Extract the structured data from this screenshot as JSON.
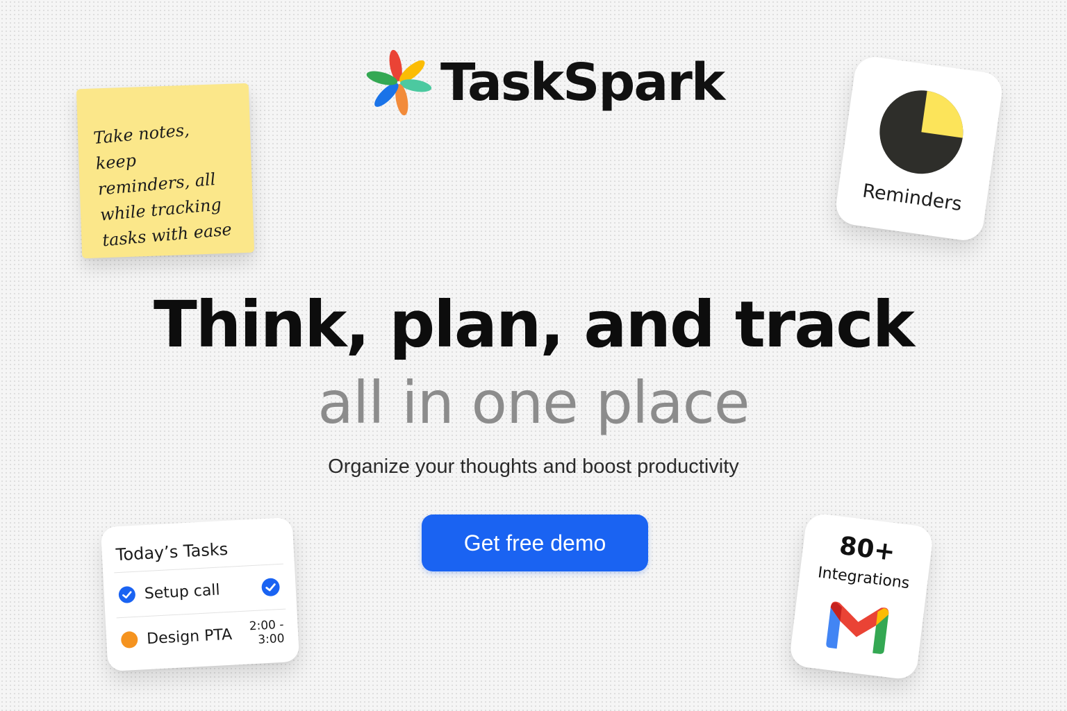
{
  "brand": {
    "name": "TaskSpark",
    "logo_icon": "pinwheel-spark-icon",
    "logo_colors": [
      "#ea4335",
      "#fbbc04",
      "#34a853",
      "#1a73e8",
      "#4cc9a0",
      "#f28b3a"
    ]
  },
  "hero": {
    "headline": "Think, plan, and track",
    "headline_secondary": "all in one place",
    "subheading": "Organize your thoughts and boost productivity",
    "cta_label": "Get free demo"
  },
  "sticky_note": {
    "lines": [
      "Take notes, keep",
      "reminders, all",
      "while tracking",
      "tasks with ease"
    ],
    "color": "#fbe78a"
  },
  "reminders_card": {
    "label": "Reminders",
    "icon": "pie-clock-icon",
    "progress_fraction": 0.25,
    "colors": {
      "fill": "#2e2e2a",
      "accent": "#fce45a"
    }
  },
  "tasks_card": {
    "title": "Today’s Tasks",
    "items": [
      {
        "name": "Setup call",
        "status": "done",
        "icon": "check-circle-icon"
      },
      {
        "name": "Design PTA",
        "status": "scheduled",
        "time_start": "2:00 -",
        "time_end": "3:00",
        "icon": "orange-dot-icon"
      }
    ],
    "colors": {
      "check": "#1a63f2",
      "dot": "#f5931f"
    }
  },
  "integrations_card": {
    "count": "80+",
    "label": "Integrations",
    "icon": "gmail-icon"
  },
  "colors": {
    "primary": "#1a63f2",
    "headline": "#0d0d0d",
    "headline_secondary": "#8c8c8c",
    "background": "#f5f5f5"
  }
}
